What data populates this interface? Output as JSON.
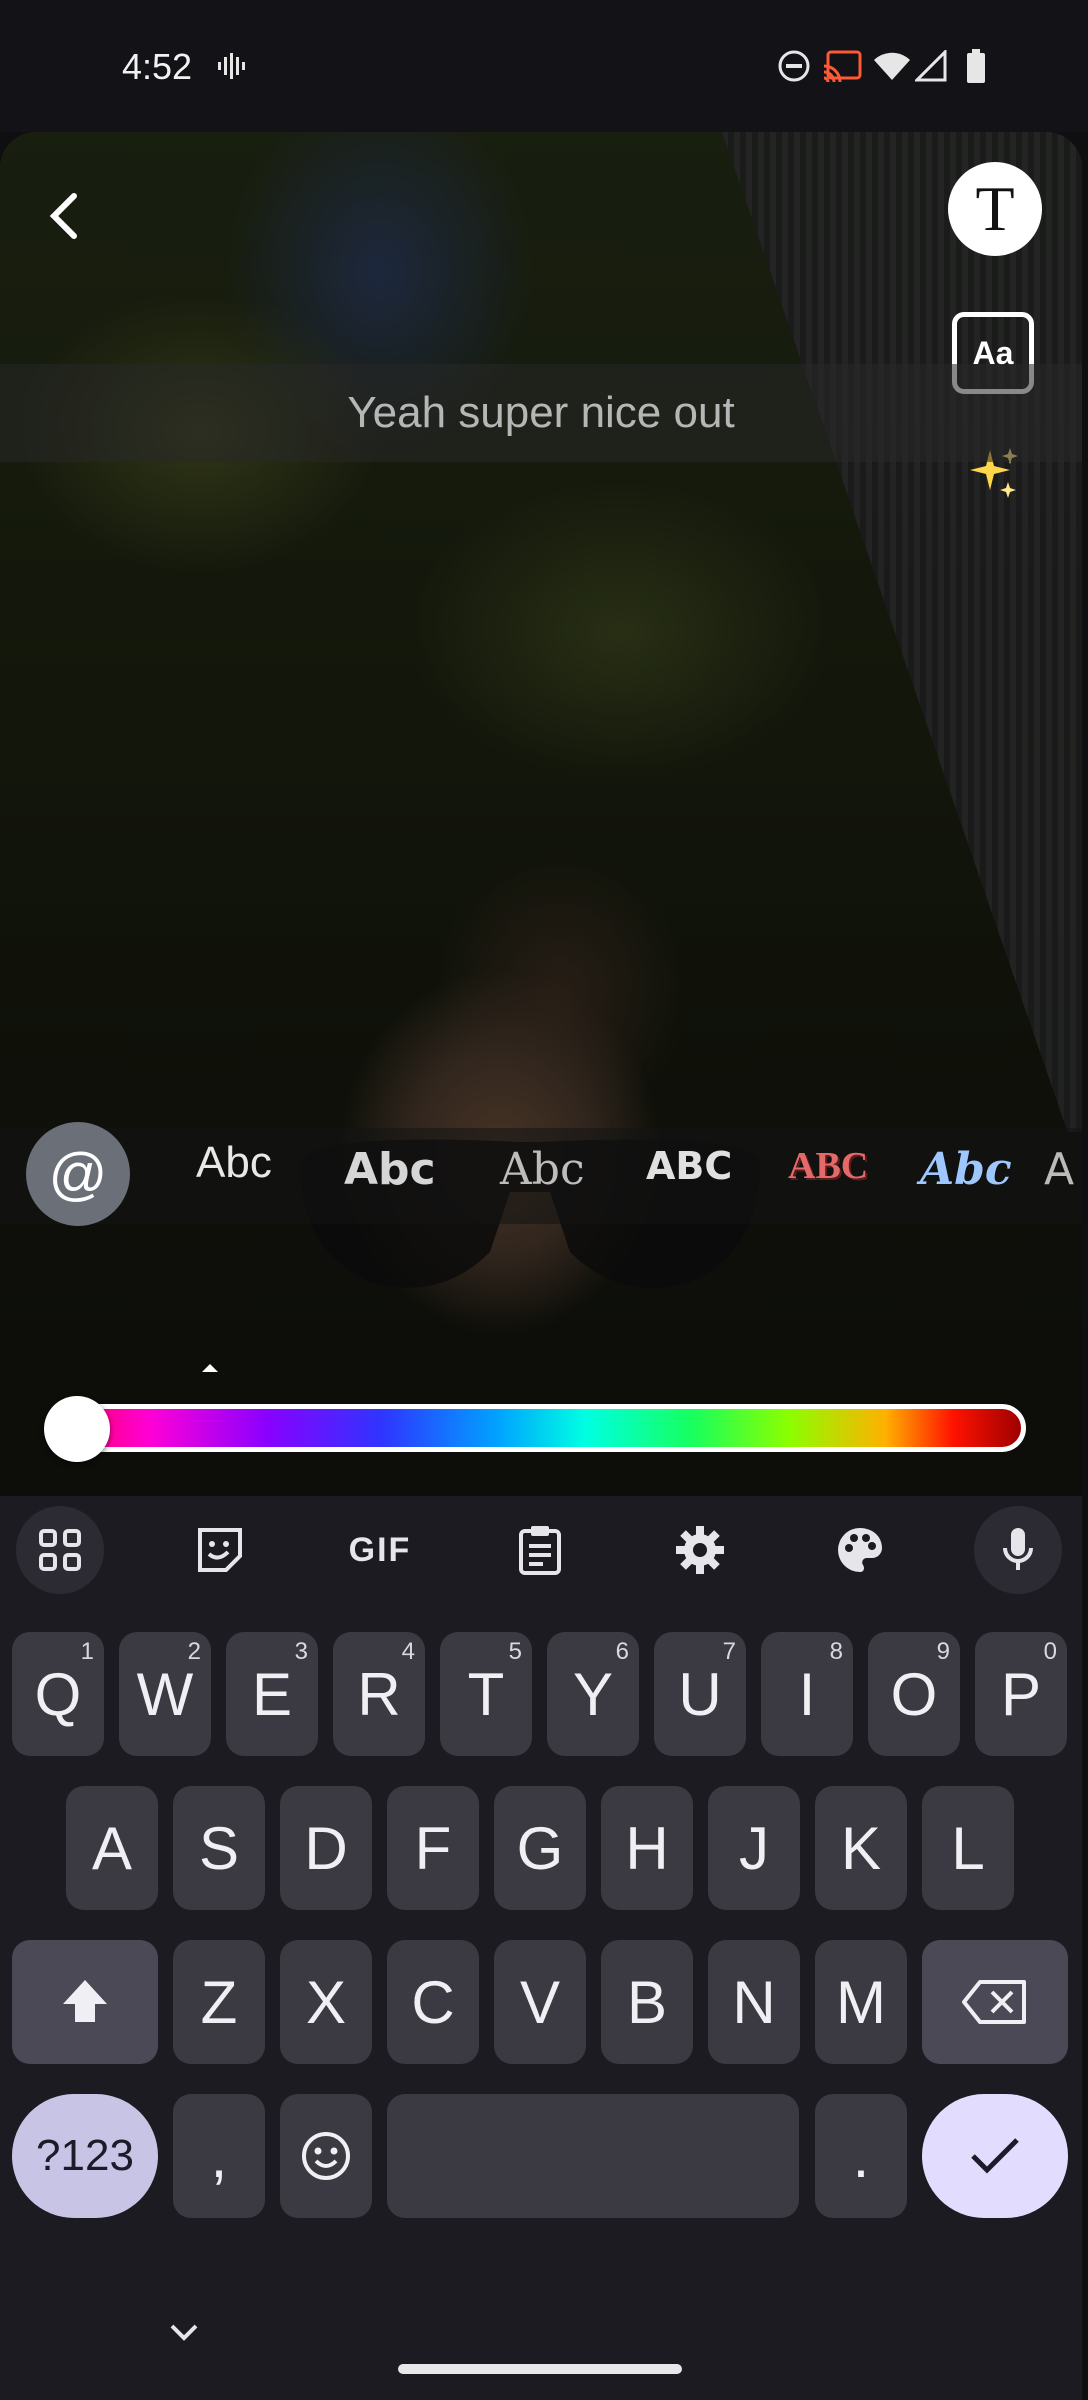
{
  "status_bar": {
    "time": "4:52",
    "icons": [
      "voice-recorder-icon",
      "do-not-disturb-icon",
      "cast-icon",
      "wifi-icon",
      "signal-icon",
      "battery-icon"
    ]
  },
  "editor": {
    "caption_text": "Yeah super nice out",
    "text_button_label": "T",
    "font_button_label": "Aa",
    "mention_label": "@",
    "text_styles": [
      "Abc",
      "Abc",
      "Abc",
      "ABC",
      "ABC",
      "Abc",
      "A"
    ],
    "selected_style_index": 0,
    "color_slider_value": 0
  },
  "keyboard": {
    "toolbar": [
      "apps-grid-icon",
      "sticker-icon",
      "GIF",
      "clipboard-icon",
      "settings-icon",
      "palette-icon",
      "microphone-icon"
    ],
    "gif_label": "GIF",
    "rows": [
      [
        {
          "label": "Q",
          "hint": "1"
        },
        {
          "label": "W",
          "hint": "2"
        },
        {
          "label": "E",
          "hint": "3"
        },
        {
          "label": "R",
          "hint": "4"
        },
        {
          "label": "T",
          "hint": "5"
        },
        {
          "label": "Y",
          "hint": "6"
        },
        {
          "label": "U",
          "hint": "7"
        },
        {
          "label": "I",
          "hint": "8"
        },
        {
          "label": "O",
          "hint": "9"
        },
        {
          "label": "P",
          "hint": "0"
        }
      ],
      [
        {
          "label": "A"
        },
        {
          "label": "S"
        },
        {
          "label": "D"
        },
        {
          "label": "F"
        },
        {
          "label": "G"
        },
        {
          "label": "H"
        },
        {
          "label": "J"
        },
        {
          "label": "K"
        },
        {
          "label": "L"
        }
      ],
      [
        {
          "label": "Z"
        },
        {
          "label": "X"
        },
        {
          "label": "C"
        },
        {
          "label": "V"
        },
        {
          "label": "B"
        },
        {
          "label": "N"
        },
        {
          "label": "M"
        }
      ]
    ],
    "symbols_label": "?123",
    "comma_label": ",",
    "period_label": ".",
    "space_label": ""
  },
  "colors": {
    "background": "#0f0f12",
    "keyboard_bg": "#1c1b22",
    "key_bg": "#3b3a42",
    "accent_enter": "#e2dcff",
    "cursor": "#29a8ff"
  }
}
